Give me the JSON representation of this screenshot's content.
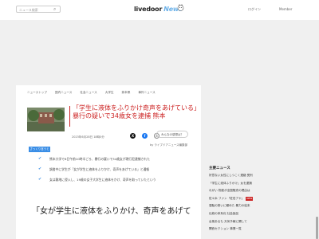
{
  "header": {
    "search_placeholder": "ニュース検索",
    "logo": "livedoor",
    "logo_suffix": "News",
    "login": "ログイン",
    "member": "Member"
  },
  "article": {
    "breadcrumb": [
      "ニューストップ",
      "国内ニュース",
      "社会ニュース",
      "大学生",
      "熊本県",
      "事件ニュース"
    ],
    "title": "「学生に液体をふりかけ奇声をあげている」暴行の疑いで34歳女を逮捕 熊本",
    "date": "2023年6月28日 18時0分",
    "recommend": "みんなの感想は？",
    "author": "by ライブドアニュース編集部",
    "tag": "ざっくり言うと",
    "bullets": [
      "熊本大学で6日午前10時半ごろ、暴行の疑いで34歳女が現行犯逮捕された",
      "調書中に学生が「女が学生に液体をふりかけ、奇声をあげている」と通報",
      "女は敷地に侵入し、19歳の女子大学生に液体をかけ、奇声を取っていたという"
    ],
    "body": "「女が学生に液体をふりかけ、奇声をあげて"
  },
  "sidebar": {
    "title": "主要ニュース",
    "items": [
      {
        "text": "好意ない女性にしつこく連絡 受刑"
      },
      {
        "text": "「学生に液体ふりかけ」女を逮捕"
      },
      {
        "text": "れがい 物産が全国販売の理由は"
      },
      {
        "text": "佐々木 ファン「佐伯アヤ」",
        "badge": "NEW"
      },
      {
        "text": "運転の勢いに頼めた 暴力の結末"
      },
      {
        "text": "伝統の体系化 社会製品"
      },
      {
        "text": "台風あるも 天気予報に関して"
      },
      {
        "text": "関西セクション 事業一覧"
      }
    ]
  },
  "colors": {
    "accent_red": "#cc2222",
    "accent_blue": "#3a8ee6",
    "logo_blue": "#6ab0e8"
  }
}
